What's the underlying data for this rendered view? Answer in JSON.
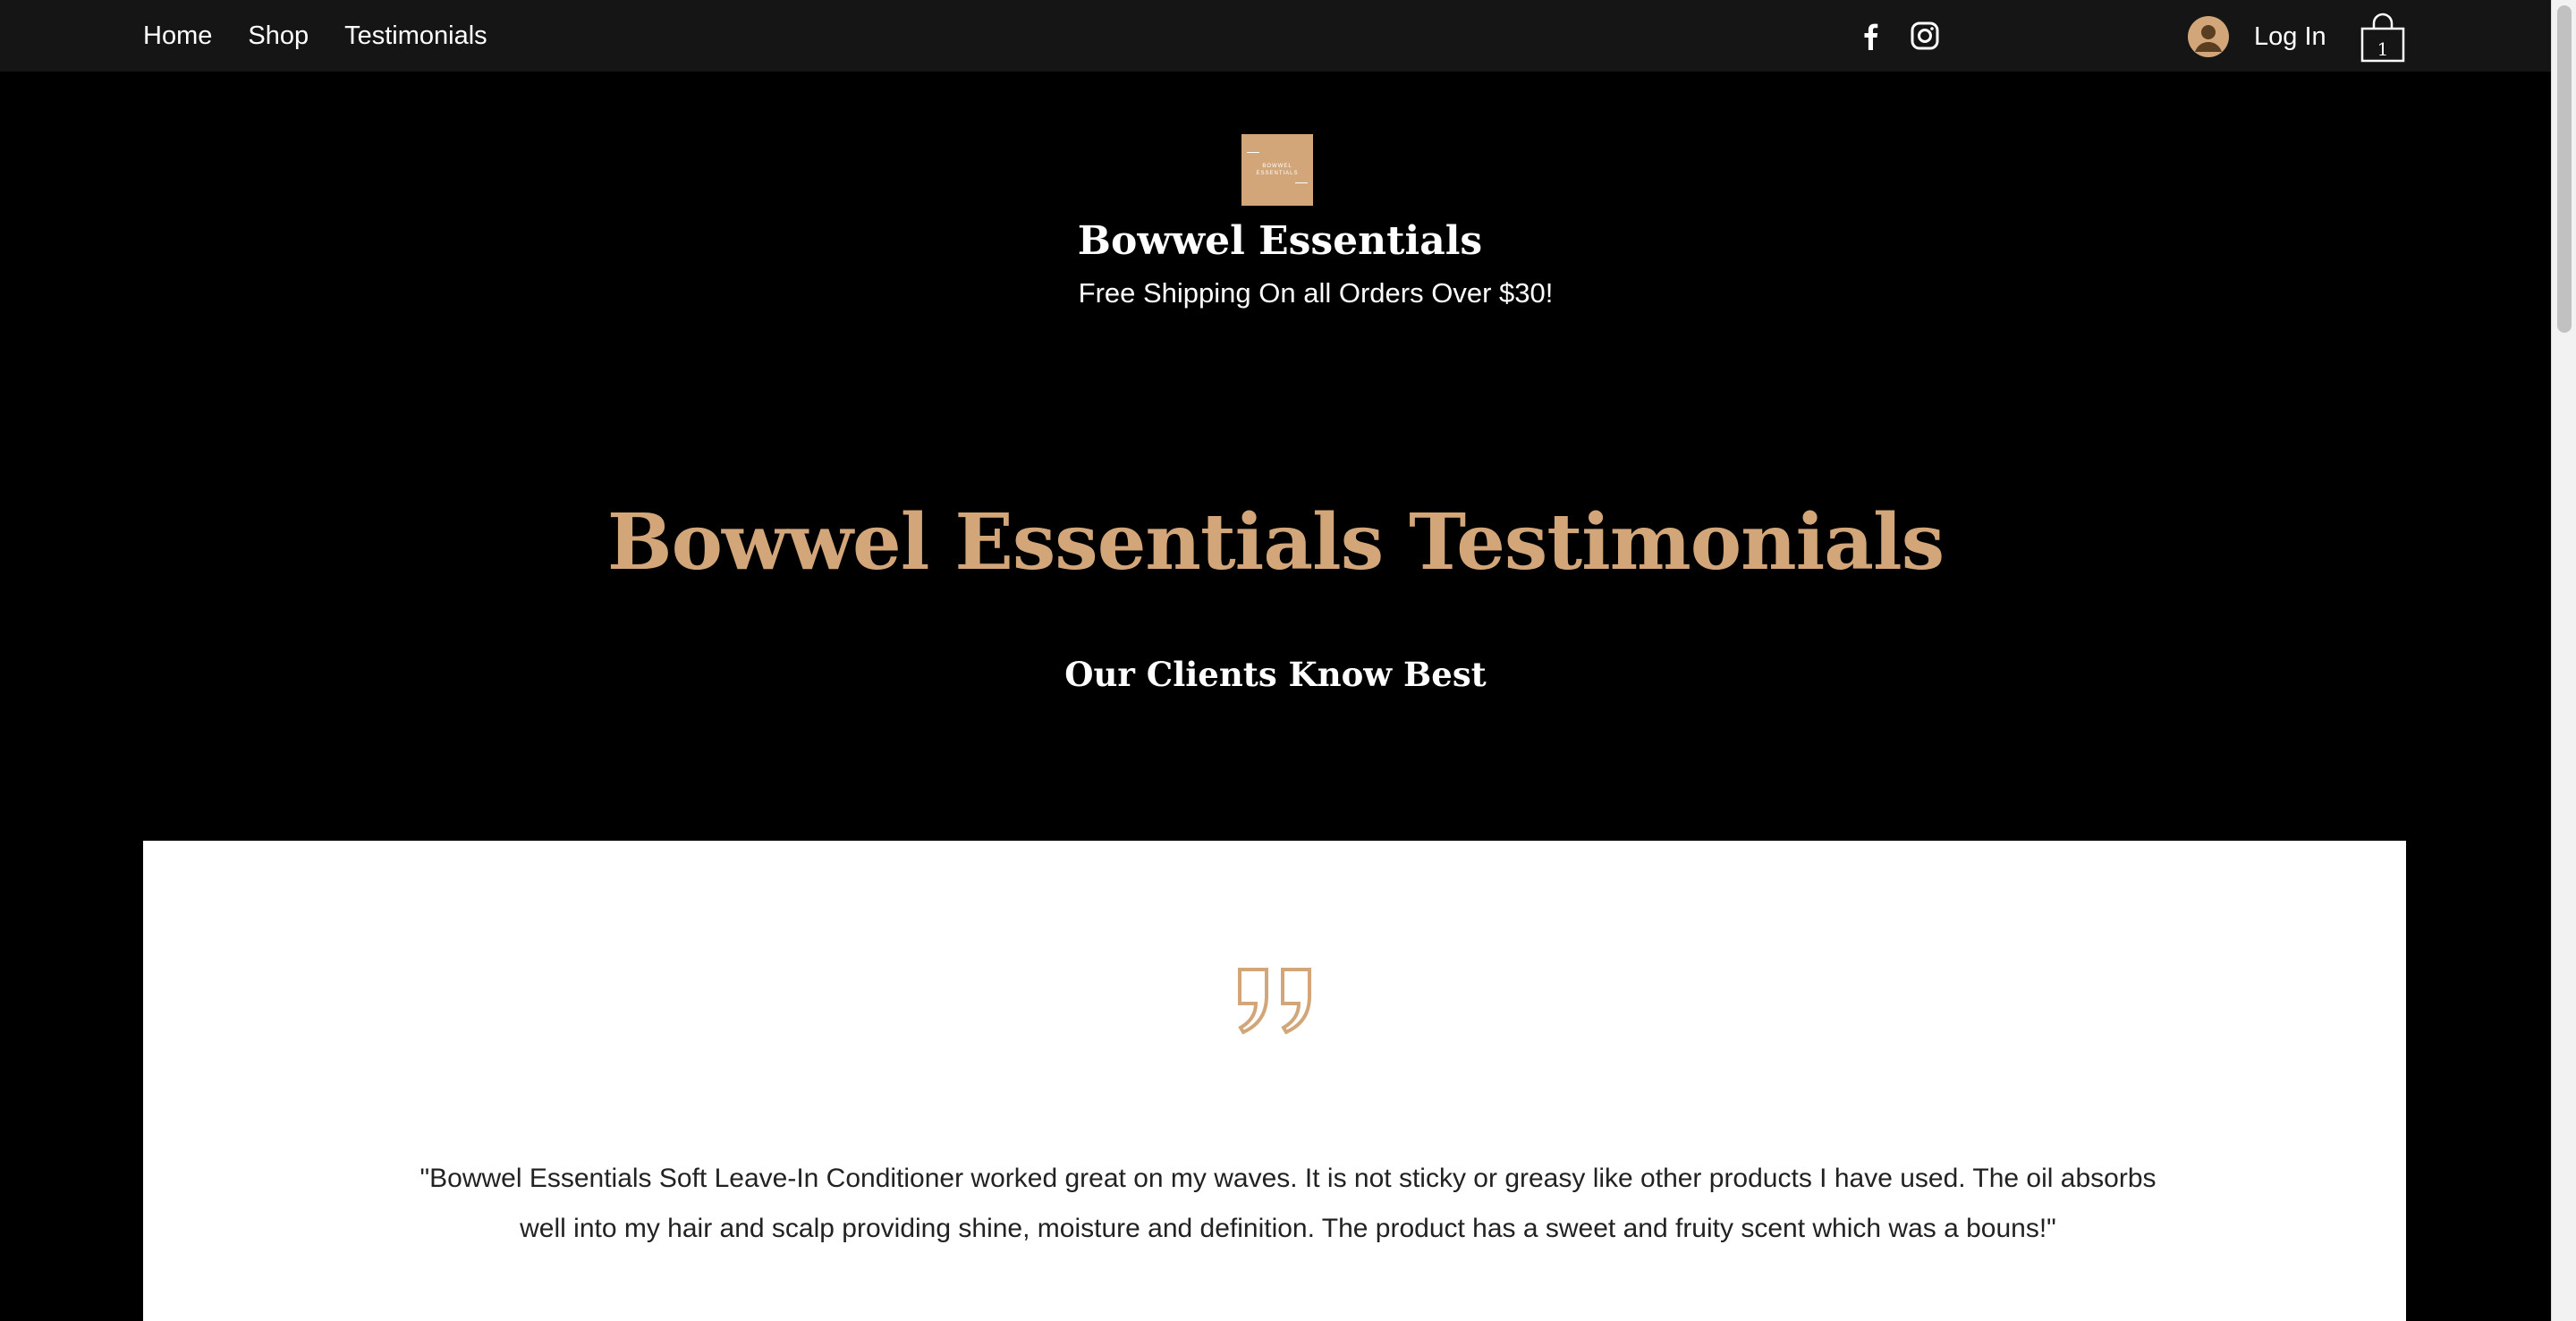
{
  "nav": {
    "items": [
      {
        "label": "Home"
      },
      {
        "label": "Shop"
      },
      {
        "label": "Testimonials"
      }
    ]
  },
  "social": {
    "icons": [
      "facebook-icon",
      "instagram-icon"
    ]
  },
  "account": {
    "login_label": "Log In"
  },
  "cart": {
    "count": "1"
  },
  "header": {
    "logo_text": "BOWWEL ESSENTIALS",
    "site_title": "Bowwel Essentials",
    "promo": "Free Shipping On all Orders Over $30!"
  },
  "hero": {
    "title": "Bowwel Essentials Testimonials",
    "subtitle": "Our Clients Know Best"
  },
  "testimonial": {
    "quote": "\"Bowwel Essentials Soft Leave-In Conditioner worked great on my waves. It is not sticky or greasy like other products I have used. The oil absorbs well into my hair and scalp providing shine, moisture and definition. The product has a sweet and fruity scent which was a bouns!\""
  },
  "colors": {
    "accent": "#d2a679",
    "topbar": "#151515",
    "background": "#000000"
  }
}
